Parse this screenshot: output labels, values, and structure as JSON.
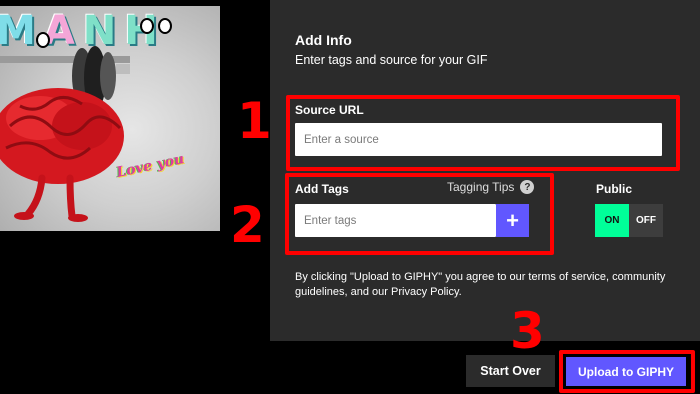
{
  "preview": {
    "title_parts": [
      "M",
      "A",
      "NH"
    ],
    "sticker_text": "Love you"
  },
  "panel": {
    "title": "Add Info",
    "subtitle": "Enter tags and source for your GIF",
    "source": {
      "label": "Source URL",
      "placeholder": "Enter a source",
      "value": ""
    },
    "tags": {
      "label": "Add Tags",
      "tips_label": "Tagging Tips",
      "help_glyph": "?",
      "placeholder": "Enter tags",
      "value": "",
      "add_glyph": "+"
    },
    "public": {
      "label": "Public",
      "on_label": "ON",
      "off_label": "OFF",
      "selected": "ON"
    },
    "terms": "By clicking \"Upload to GIPHY\" you agree to our terms of service, community guidelines, and our Privacy Policy."
  },
  "actions": {
    "start_over": "Start Over",
    "upload": "Upload to GIPHY"
  },
  "annotations": {
    "step1": "1",
    "step2": "2",
    "step3": "3"
  },
  "colors": {
    "panel_bg": "#2b2b2b",
    "accent_purple": "#6157ff",
    "toggle_on": "#00ff99",
    "annotation_red": "#ff0000"
  }
}
